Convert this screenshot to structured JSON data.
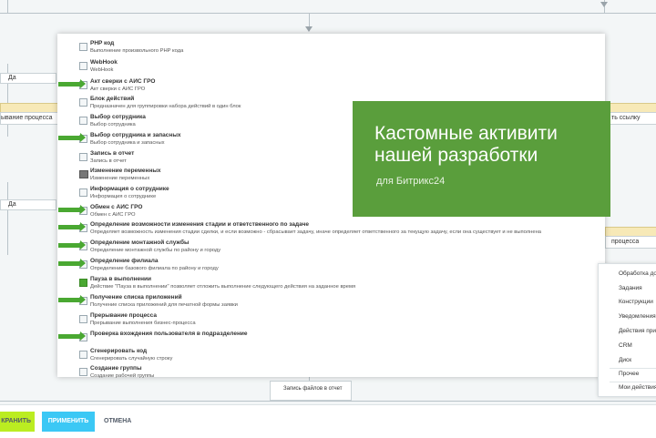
{
  "background": {
    "left_labels": [
      "Да",
      "Да"
    ],
    "left_process": "ывание процесса",
    "right_top": "ть ссылку",
    "right_mid": "процесса",
    "bottom_activity": "Запись файлов в отчет"
  },
  "activities": [
    {
      "title": "PHP код",
      "desc": "Выполнение произвольного PHP кода",
      "arrow": false,
      "icon": "code-icon"
    },
    {
      "title": "WebHook",
      "desc": "WebHook",
      "arrow": false,
      "icon": "webhook-icon"
    },
    {
      "title": "Акт сверки с АИС ГРО",
      "desc": "Акт сверки с АИС ГРО",
      "arrow": true,
      "icon": "document-icon"
    },
    {
      "title": "Блок действий",
      "desc": "Предназначен для группировки набора действий в один блок",
      "arrow": false,
      "icon": "block-icon"
    },
    {
      "title": "Выбор сотрудника",
      "desc": "Выбор сотрудника",
      "arrow": false,
      "icon": "user-icon"
    },
    {
      "title": "Выбор сотрудника и запасных",
      "desc": "Выбор сотрудника и запасных",
      "arrow": true,
      "icon": "user-icon"
    },
    {
      "title": "Запись в отчет",
      "desc": "Запись в отчет",
      "arrow": false,
      "icon": "report-icon"
    },
    {
      "title": "Изменение переменных",
      "desc": "Изменение переменных",
      "arrow": false,
      "icon": "variable-icon"
    },
    {
      "title": "Информация о сотруднике",
      "desc": "Информация о сотруднике",
      "arrow": false,
      "icon": "info-icon"
    },
    {
      "title": "Обмен с АИС ГРО",
      "desc": "Обмен с АИС ГРО",
      "arrow": true,
      "icon": "exchange-icon"
    },
    {
      "title": "Определение возможности изменения стадии и ответственного по задаче",
      "desc": "Определяет возможность изменения стадии сделки, и если возможно - сбрасывает задачу, иначе определяет ответственного за текущую задачу, если она существует и не выполнена",
      "arrow": true,
      "icon": "task-icon"
    },
    {
      "title": "Определение монтажной службы",
      "desc": "Определение монтажной службы по району и городу",
      "arrow": true,
      "icon": "service-icon"
    },
    {
      "title": "Определение филиала",
      "desc": "Определение базового филиала по району и городу",
      "arrow": true,
      "icon": "branch-icon"
    },
    {
      "title": "Пауза в выполнении",
      "desc": "Действие \"Пауза в выполнении\" позволяет отложить выполнение следующего действия на заданное время",
      "arrow": false,
      "icon": "pause-icon"
    },
    {
      "title": "Получение списка приложений",
      "desc": "Получение списка приложений для печатной формы заявки",
      "arrow": true,
      "icon": "list-icon"
    },
    {
      "title": "Прерывание процесса",
      "desc": "Прерывание выполнения бизнес-процесса",
      "arrow": false,
      "icon": "stop-icon"
    },
    {
      "title": "Проверка вхождения пользователя в подразделение",
      "desc": "",
      "arrow": true,
      "icon": "check-icon"
    },
    {
      "title": "Сгенерировать код",
      "desc": "Сгенерировать случайную строку",
      "arrow": false,
      "icon": "generate-icon"
    },
    {
      "title": "Создание группы",
      "desc": "Создание рабочей группы",
      "arrow": false,
      "icon": "group-icon"
    }
  ],
  "promo": {
    "headline_line1": "Кастомные активити",
    "headline_line2": "нашей разработки",
    "subline": "для Битрикс24",
    "color": "#5a9e3c"
  },
  "context_menu": [
    "Обработка до",
    "Задания",
    "Конструкции",
    "Уведомления",
    "Действия при",
    "CRM",
    "Диск",
    "Прочее",
    "Мои действия"
  ],
  "buttons": {
    "save": "КРАНИТЬ",
    "apply": "ПРИМЕНИТЬ",
    "cancel": "ОТМЕНА"
  }
}
